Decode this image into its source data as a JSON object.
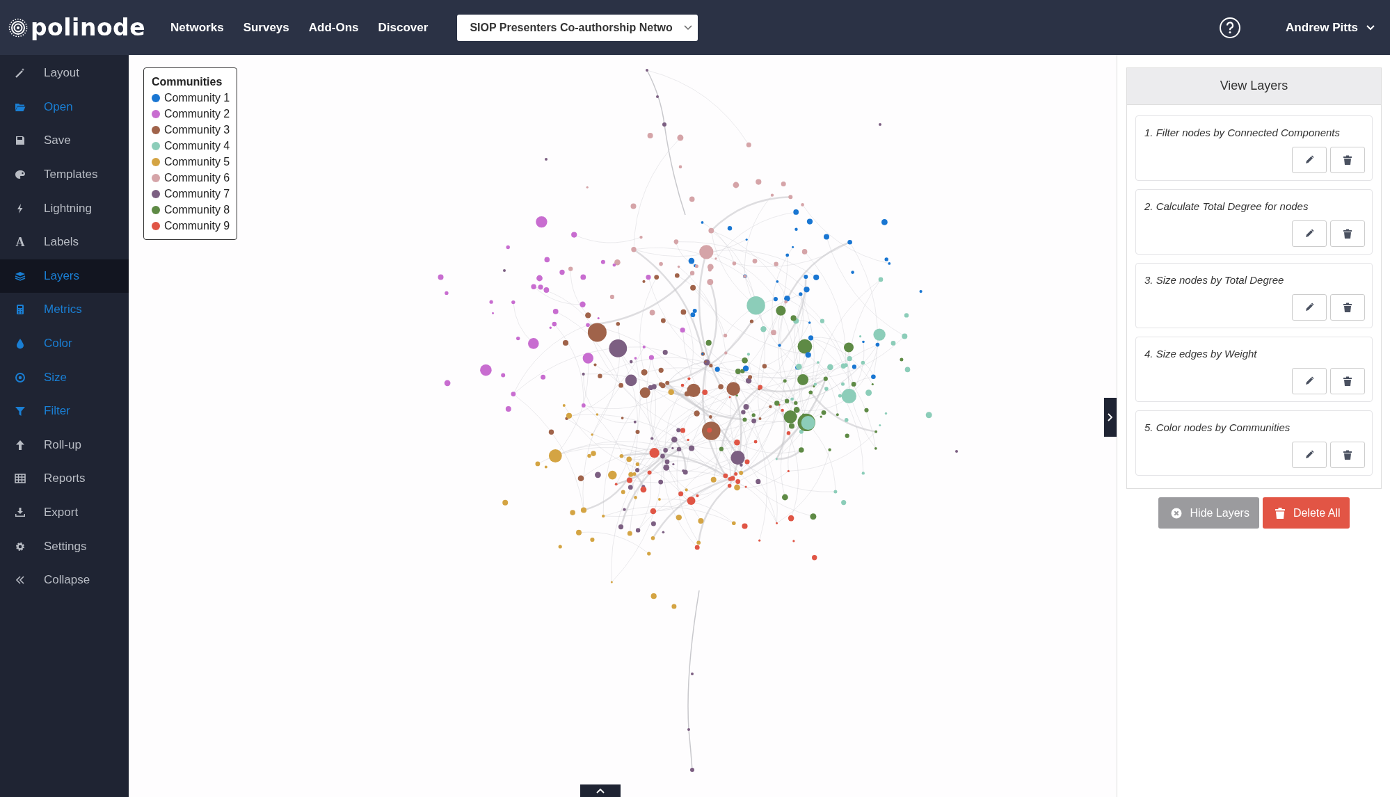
{
  "topbar": {
    "logo": "polinode",
    "nav": [
      {
        "label": "Networks"
      },
      {
        "label": "Surveys"
      },
      {
        "label": "Add-Ons"
      },
      {
        "label": "Discover"
      }
    ],
    "network_select": {
      "value": "SIOP Presenters Co-authorship Netwo"
    },
    "user": "Andrew Pitts"
  },
  "sidebar": {
    "items": [
      {
        "label": "Layout",
        "selected": false,
        "active": false
      },
      {
        "label": "Open",
        "selected": false,
        "active": true
      },
      {
        "label": "Save",
        "selected": false,
        "active": false
      },
      {
        "label": "Templates",
        "selected": false,
        "active": false
      },
      {
        "label": "Lightning",
        "selected": false,
        "active": false
      },
      {
        "label": "Labels",
        "glyph": "A",
        "selected": false,
        "active": false
      },
      {
        "label": "Layers",
        "selected": true,
        "active": true
      },
      {
        "label": "Metrics",
        "selected": false,
        "active": true
      },
      {
        "label": "Color",
        "selected": false,
        "active": true
      },
      {
        "label": "Size",
        "selected": false,
        "active": true
      },
      {
        "label": "Filter",
        "selected": false,
        "active": true
      },
      {
        "label": "Roll-up",
        "selected": false,
        "active": false
      },
      {
        "label": "Reports",
        "selected": false,
        "active": false
      },
      {
        "label": "Export",
        "selected": false,
        "active": false
      },
      {
        "label": "Settings",
        "selected": false,
        "active": false
      },
      {
        "label": "Collapse",
        "selected": false,
        "active": false
      }
    ]
  },
  "legend": {
    "title": "Communities",
    "items": [
      {
        "label": "Community 1",
        "color": "#1976d2"
      },
      {
        "label": "Community 2",
        "color": "#c86dd0"
      },
      {
        "label": "Community 3",
        "color": "#a0634a"
      },
      {
        "label": "Community 4",
        "color": "#8ccdb9"
      },
      {
        "label": "Community 5",
        "color": "#d4a443"
      },
      {
        "label": "Community 6",
        "color": "#d5a4a8"
      },
      {
        "label": "Community 7",
        "color": "#7c5f82"
      },
      {
        "label": "Community 8",
        "color": "#5e8a45"
      },
      {
        "label": "Community 9",
        "color": "#e05545"
      }
    ]
  },
  "layers_panel": {
    "title": "View Layers",
    "layers": [
      {
        "label": "1. Filter nodes by Connected Components"
      },
      {
        "label": "2. Calculate Total Degree for nodes"
      },
      {
        "label": "3. Size nodes by Total Degree"
      },
      {
        "label": "4. Size edges by Weight"
      },
      {
        "label": "5. Color nodes by Communities"
      }
    ],
    "buttons": [
      {
        "label": "Hide Layers",
        "kind": "secondary"
      },
      {
        "label": "Delete All",
        "kind": "danger"
      }
    ]
  }
}
